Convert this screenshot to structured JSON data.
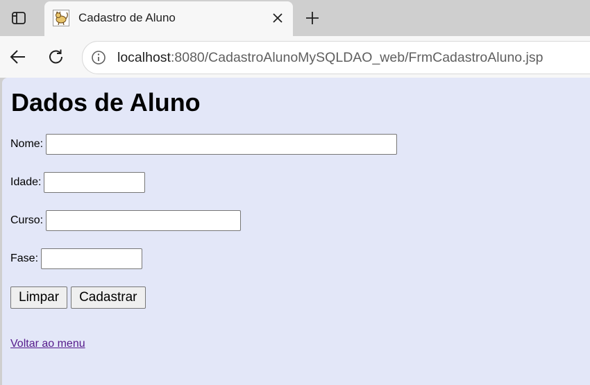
{
  "browser": {
    "tab": {
      "title": "Cadastro de Aluno",
      "favicon": "tomcat-icon"
    },
    "address_bar": {
      "host": "localhost",
      "path": ":8080/CadastroAlunoMySQLDAO_web/FrmCadastroAluno.jsp"
    },
    "icons": [
      "sidebar-icon",
      "close-icon",
      "plus-icon",
      "back-arrow-icon",
      "reload-icon",
      "info-icon"
    ]
  },
  "page": {
    "title": "Dados de Aluno",
    "form": {
      "nome": {
        "label": "Nome:",
        "value": ""
      },
      "idade": {
        "label": "Idade:",
        "value": ""
      },
      "curso": {
        "label": "Curso:",
        "value": ""
      },
      "fase": {
        "label": "Fase:",
        "value": ""
      }
    },
    "buttons": {
      "limpar": "Limpar",
      "cadastrar": "Cadastrar"
    },
    "menu_link": "Voltar ao menu"
  },
  "colors": {
    "page_background": "#e3e7f8",
    "visited_link": "#551a8b",
    "tab_strip": "#cfcfcf"
  }
}
